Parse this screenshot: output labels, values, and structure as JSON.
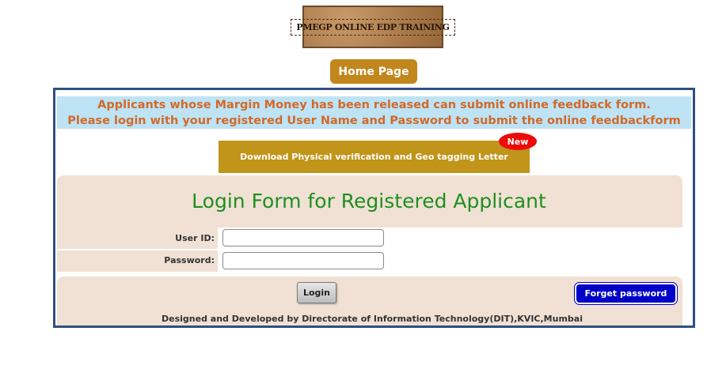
{
  "header": {
    "logo_text": "PMEGP ONLINE EDP TRAINING",
    "home_label": "Home Page"
  },
  "notice": {
    "line1": "Applicants whose Margin Money has been released can submit online feedback form.",
    "line2": "Please login with your registered User Name and Password to submit the online feedbackform"
  },
  "download": {
    "label": "Download Physical verification and Geo tagging Letter",
    "badge": "New"
  },
  "login_form": {
    "title": "Login Form for Registered Applicant",
    "user_id_label": "User ID:",
    "user_id_value": "",
    "password_label": "Password:",
    "password_value": "",
    "login_label": "Login",
    "forget_label": "Forget password"
  },
  "footer": {
    "credit": "Designed and Developed by Directorate of Information Technology(DIT),KVIC,Mumbai"
  },
  "colors": {
    "home_button": "#c1861c",
    "download_button": "#c1941a",
    "notice_background": "#bde3f4",
    "notice_text": "#d2692a",
    "panel_background": "#f0e1d4",
    "title_text": "#1f8f1f",
    "forget_button": "#0000c8",
    "new_badge": "#ee0a0a",
    "frame_border": "#2f4f7f"
  }
}
